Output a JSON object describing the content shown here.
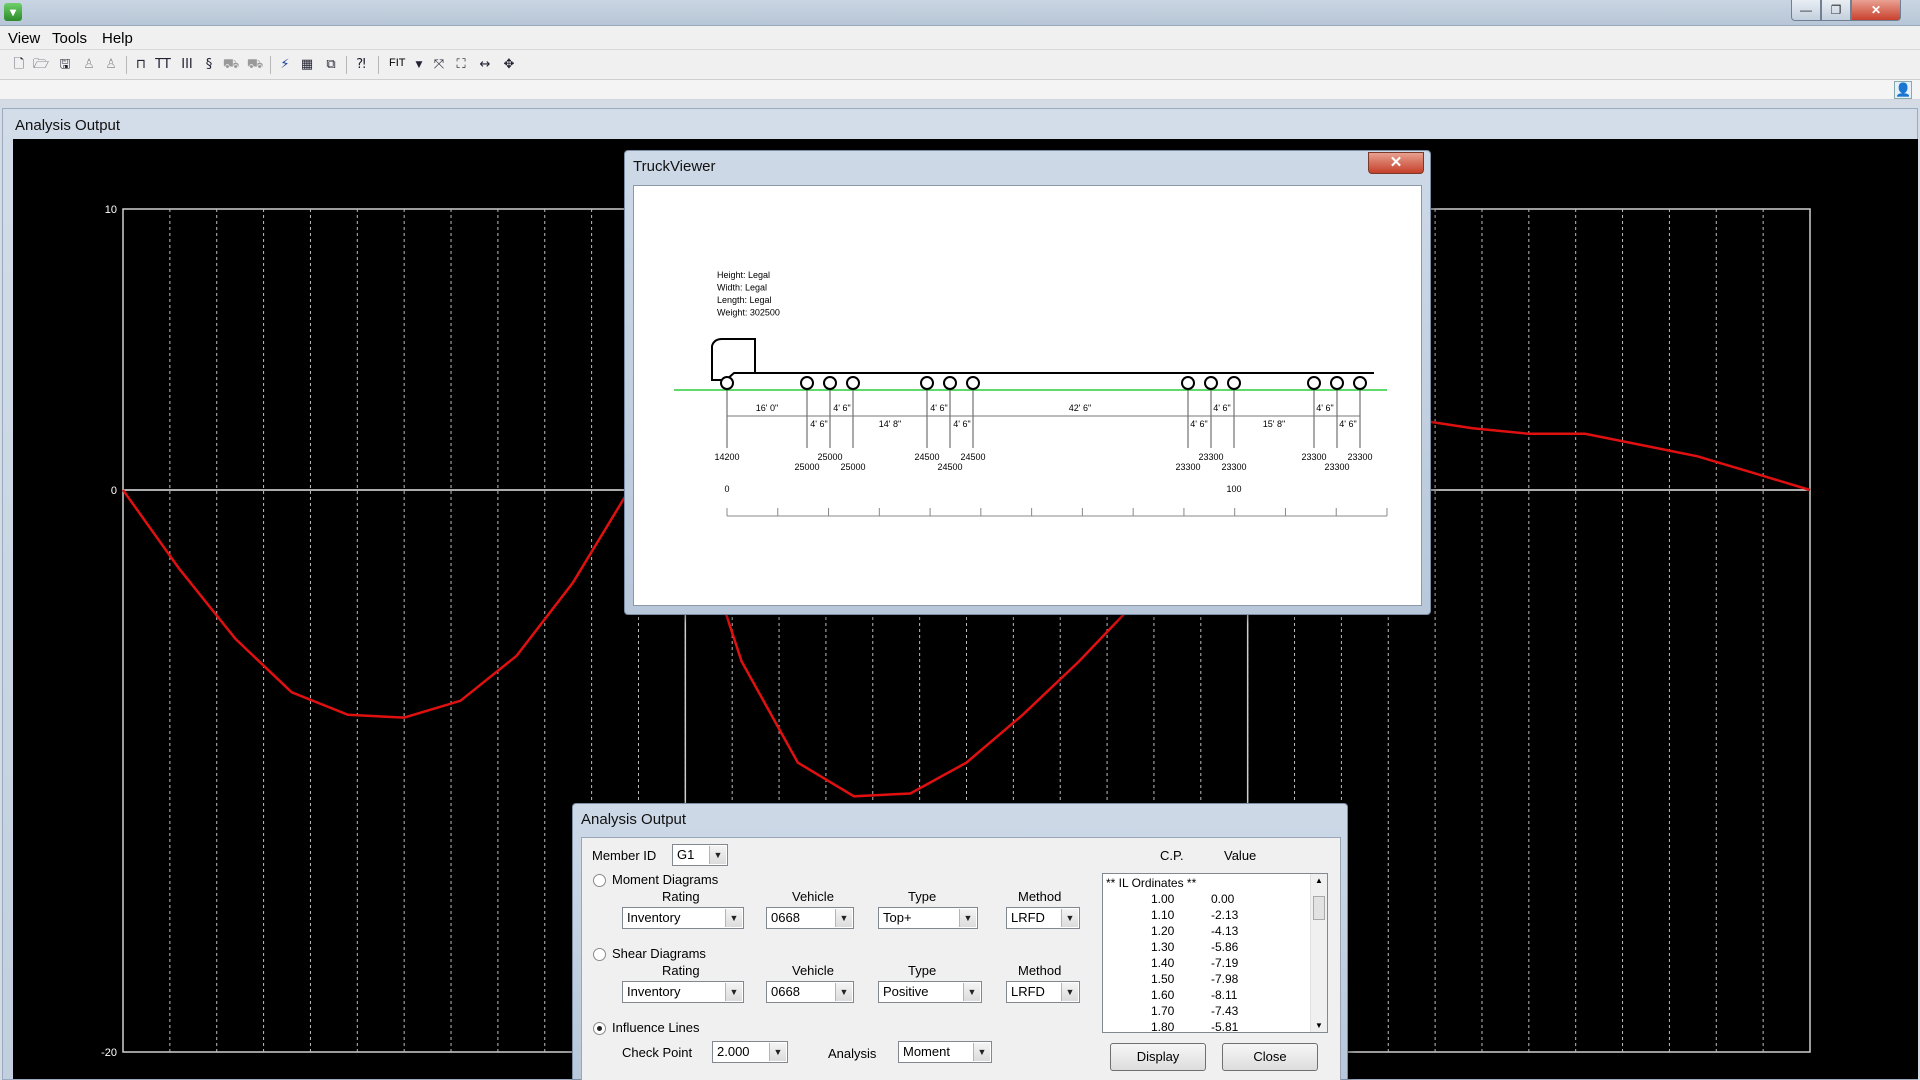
{
  "menu": {
    "items": [
      "View",
      "Tools",
      "Help"
    ]
  },
  "toolbar": {
    "fit_label": "FIT"
  },
  "window": {
    "close_glyph": "✕",
    "min_glyph": "—",
    "max_glyph": "❐"
  },
  "child_window": {
    "title": "Analysis Output"
  },
  "chart_data": {
    "type": "line",
    "title": "",
    "xlabel": "",
    "ylabel": "",
    "ylim": [
      -20,
      10
    ],
    "y_ticks": [
      "10",
      "0",
      "-20"
    ],
    "grid": "vertical dashed",
    "series": [
      {
        "color": "#e01010",
        "x": [
          0,
          0.1,
          0.2,
          0.3,
          0.4,
          0.5,
          0.6,
          0.7,
          0.8,
          0.9,
          1.0,
          1.1,
          1.2,
          1.3,
          1.4,
          1.5,
          1.6,
          1.7,
          1.8,
          1.9,
          2.0,
          2.1,
          2.2,
          2.3,
          2.4,
          2.5,
          2.6,
          2.7,
          2.8,
          2.9,
          3.0
        ],
        "y": [
          0,
          -2.8,
          -5.3,
          -7.2,
          -8.0,
          -8.1,
          -7.5,
          -5.9,
          -3.3,
          0.0,
          0.0,
          -6.1,
          -9.7,
          -10.9,
          -10.8,
          -9.7,
          -8.0,
          -6.1,
          -4.0,
          -1.8,
          0.4,
          1.5,
          2.1,
          2.5,
          2.2,
          2.0,
          2.0,
          1.6,
          1.2,
          0.6,
          0.0
        ]
      }
    ]
  },
  "truck_viewer": {
    "title": "TruckViewer",
    "close_glyph": "✕",
    "info": [
      "Height: Legal",
      "Width: Legal",
      "Length: Legal",
      "Weight: 302500"
    ],
    "spacings": [
      "16' 0\"",
      "4' 6\"",
      "4' 6\"",
      "14' 8\"",
      "4' 6\"",
      "4' 6\"",
      "42' 6\"",
      "4' 6\"",
      "4' 6\"",
      "15' 8\"",
      "4' 6\"",
      "4' 6\""
    ],
    "axle_loads": [
      "14200",
      "25000",
      "25000",
      "25000",
      "24500",
      "24500",
      "24500",
      "23300",
      "23300",
      "23300",
      "23300",
      "23300",
      "23300"
    ],
    "scale_labels": [
      "0",
      "100"
    ]
  },
  "analysis_dialog": {
    "title": "Analysis Output",
    "member_id_label": "Member ID",
    "member_id_value": "G1",
    "moment_label": "Moment Diagrams",
    "shear_label": "Shear Diagrams",
    "influence_label": "Influence Lines",
    "col_rating": "Rating",
    "col_vehicle": "Vehicle",
    "col_type": "Type",
    "col_method": "Method",
    "moment": {
      "rating": "Inventory",
      "vehicle": "0668",
      "type": "Top+",
      "method": "LRFD"
    },
    "shear": {
      "rating": "Inventory",
      "vehicle": "0668",
      "type": "Positive",
      "method": "LRFD"
    },
    "check_point_label": "Check Point",
    "check_point_value": "2.000",
    "analysis_label": "Analysis",
    "analysis_value": "Moment",
    "list_header_cp": "C.P.",
    "list_header_value": "Value",
    "il_header": "** IL Ordinates **",
    "il_rows": [
      {
        "cp": "1.00",
        "value": "0.00"
      },
      {
        "cp": "1.10",
        "value": "-2.13"
      },
      {
        "cp": "1.20",
        "value": "-4.13"
      },
      {
        "cp": "1.30",
        "value": "-5.86"
      },
      {
        "cp": "1.40",
        "value": "-7.19"
      },
      {
        "cp": "1.50",
        "value": "-7.98"
      },
      {
        "cp": "1.60",
        "value": "-8.11"
      },
      {
        "cp": "1.70",
        "value": "-7.43"
      },
      {
        "cp": "1.80",
        "value": "-5.81"
      }
    ],
    "display_label": "Display",
    "close_label": "Close"
  }
}
